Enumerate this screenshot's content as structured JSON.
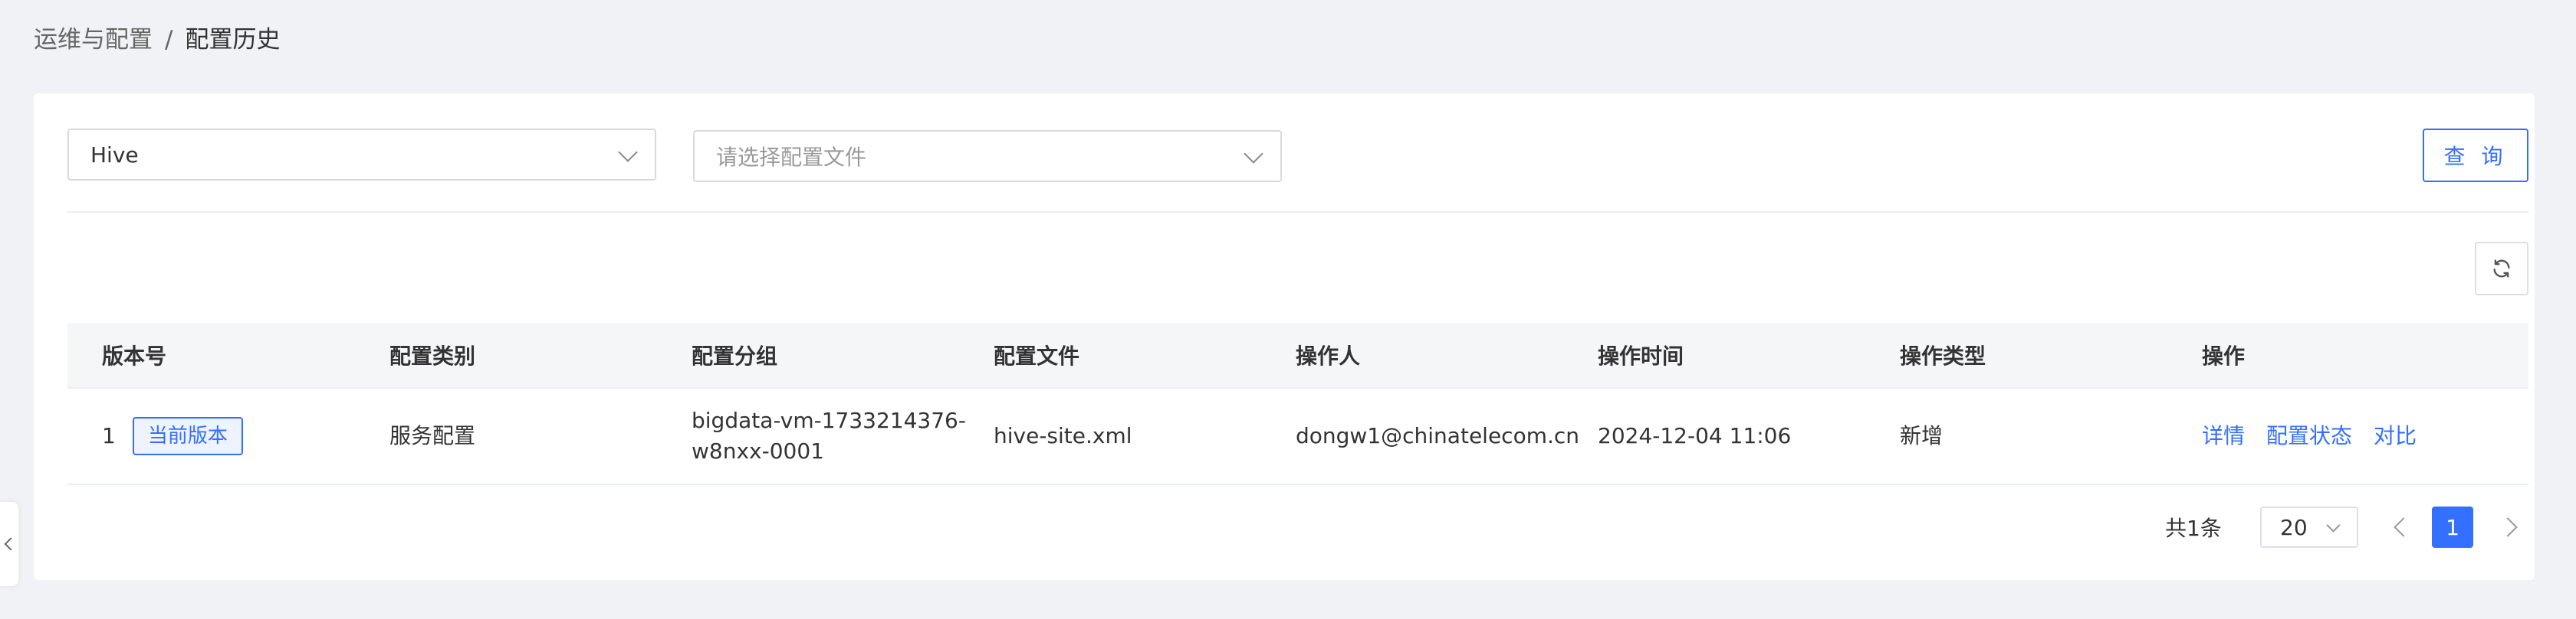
{
  "breadcrumb": {
    "parent": "运维与配置",
    "separator": "/",
    "current": "配置历史"
  },
  "filters": {
    "service_value": "Hive",
    "file_placeholder": "请选择配置文件",
    "query_label": "查 询"
  },
  "table": {
    "headers": [
      "版本号",
      "配置类别",
      "配置分组",
      "配置文件",
      "操作人",
      "操作时间",
      "操作类型",
      "操作"
    ],
    "rows": [
      {
        "version": "1",
        "current_badge": "当前版本",
        "category": "服务配置",
        "group_line1": "bigdata-vm-1733214376-",
        "group_line2": "w8nxx-0001",
        "file": "hive-site.xml",
        "operator": "dongw1@chinatelecom.cn",
        "time": "2024-12-04 11:06",
        "op_type": "新增",
        "actions": [
          "详情",
          "配置状态",
          "对比"
        ]
      }
    ]
  },
  "pagination": {
    "total": "共1条",
    "page_size": "20",
    "current_page": "1"
  },
  "colors": {
    "accent": "#3370ff",
    "background": "#f0f2f5"
  },
  "icons": {
    "refresh": "refresh-icon",
    "sidebar_toggle": "chevron-left-icon"
  }
}
